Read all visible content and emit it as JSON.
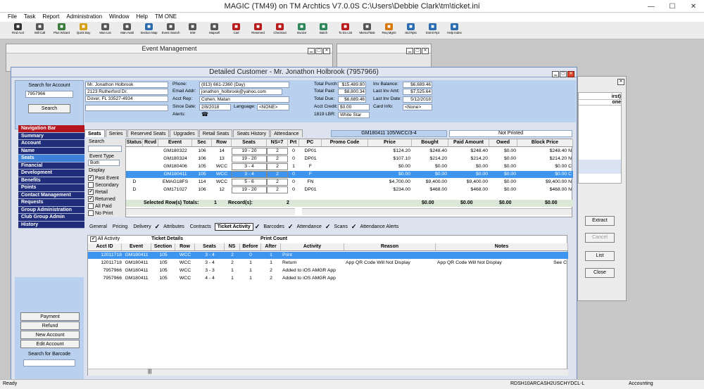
{
  "app_title": "MAGIC (TM49) on TM Archtics V7.0.0S C:\\Users\\Debbie Clark\\tm\\ticket.ini",
  "menu": [
    "File",
    "Task",
    "Report",
    "Administration",
    "Window",
    "Help",
    "TM ONE"
  ],
  "toolbar": [
    {
      "label": "Find Acct",
      "icon": "find-icon",
      "color": "#333333"
    },
    {
      "label": "Will Call",
      "icon": "will-call-icon",
      "color": "#555555"
    },
    {
      "label": "Plus Wizard",
      "icon": "wizard-icon",
      "color": "#3a7a3a"
    },
    {
      "label": "Quick Buy",
      "icon": "quick-buy-icon",
      "color": "#d4a017"
    },
    {
      "label": "Man List",
      "icon": "list-icon",
      "color": "#555555"
    },
    {
      "label": "Man Avail",
      "icon": "avail-icon",
      "color": "#555555"
    },
    {
      "label": "Section Map",
      "icon": "map-icon",
      "color": "#2b6cb0"
    },
    {
      "label": "Event Search",
      "icon": "search-icon",
      "color": "#555555"
    },
    {
      "label": "ISM",
      "icon": "ism-icon",
      "color": "#555555"
    },
    {
      "label": "Mapsell",
      "icon": "mapsell-icon",
      "color": "#555555"
    },
    {
      "label": "Cart",
      "icon": "cart-icon",
      "color": "#b91c1c"
    },
    {
      "label": "Reserved",
      "icon": "reserved-icon",
      "color": "#b91c1c"
    },
    {
      "label": "Checkout",
      "icon": "checkout-icon",
      "color": "#b91c1c"
    },
    {
      "label": "Invoice",
      "icon": "invoice-icon",
      "color": "#2f855a"
    },
    {
      "label": "Batch",
      "icon": "batch-icon",
      "color": "#2f855a"
    },
    {
      "label": "To Do List",
      "icon": "todo-icon",
      "color": "#b91c1c"
    },
    {
      "label": "Memo/Task",
      "icon": "memo-icon",
      "color": "#555555"
    },
    {
      "label": "Req Mgmt",
      "icon": "request-icon",
      "color": "#d97706"
    },
    {
      "label": "Std Rpts",
      "icon": "report-icon",
      "color": "#2b6cb0"
    },
    {
      "label": "Extrnl Rpt",
      "icon": "external-report-icon",
      "color": "#2b6cb0"
    },
    {
      "label": "Help Index",
      "icon": "help-icon",
      "color": "#2b6cb0"
    }
  ],
  "event_mgmt_title": "Event Management",
  "detail_title": "Detailed Customer - Mr. Jonathon Holbrook (7957966)",
  "search": {
    "label": "Search for Account",
    "value": "7957966",
    "button": "Search"
  },
  "address": [
    "Mr. Jonathon Holbrook",
    "2123 Rutherford Dr.",
    "Dover, FL  33527-4934"
  ],
  "contact": {
    "phone_label": "Phone:",
    "phone": "(813) 661-2360 (Day)",
    "email_label": "Email Addr:",
    "email": "jonathon_holbrook@yahoo.com",
    "rep_label": "Acct Rep:",
    "rep": "Cohen, Matan",
    "since_label": "Since Date:",
    "since": "2/8/2018",
    "language_label": "Language:",
    "language": "<NONE>",
    "alerts_label": "Alerts:"
  },
  "totals": {
    "purch_label": "Total Purch:",
    "purch": "$15,489.80",
    "paid_label": "Total Paid:",
    "paid": "$8,800.34",
    "due_label": "Total Due:",
    "due": "$6,689.46",
    "credit_label": "Acct Credit:",
    "credit": "$0.00",
    "lbr_label": "1819 LBR:",
    "lbr": "White Star",
    "inv_bal_label": "Inv Balance:",
    "inv_bal": "$6,689.46",
    "last_inv_amt_label": "Last Inv Amt:",
    "last_inv_amt": "$7,525.64",
    "last_inv_date_label": "Last Inv Date:",
    "last_inv_date": "5/12/2018",
    "card_label": "Card Info:",
    "card": "<None>"
  },
  "nav": [
    "Navigation Bar",
    "Summary",
    "Account",
    "Name",
    "Seats",
    "Financial",
    "Development",
    "Benefits",
    "Points",
    "Contact Management",
    "Requests",
    "Group Administration",
    "Club Group Admin",
    "History"
  ],
  "nav_selected": "Seats",
  "side_buttons": [
    "Payment",
    "Refund",
    "New Account",
    "Edit Account"
  ],
  "barcode_label": "Search for Barcode",
  "seats_tabs": [
    "Seats",
    "Series",
    "Reserved Seats",
    "Upgrades",
    "Retail Seats",
    "Seats History",
    "Attendance"
  ],
  "seats_info": {
    "event_box": "GM180411 105/WCC/3-4",
    "print_box": "Not Printed"
  },
  "seats_search_label": "Search",
  "event_type_label": "Event Type",
  "event_type_value": "Both",
  "display_label": "Display",
  "display_options": [
    {
      "label": "Past Event",
      "checked": "✔"
    },
    {
      "label": "Secondary",
      "checked": ""
    },
    {
      "label": "Retail",
      "checked": "✔"
    },
    {
      "label": "Returned",
      "checked": "✔"
    },
    {
      "label": "All Paid",
      "checked": ""
    },
    {
      "label": "No Print",
      "checked": ""
    }
  ],
  "seats_grid": {
    "headers": [
      "Status",
      "Rcvd",
      "Event",
      "Sec",
      "Row",
      "Seats",
      "NS=7",
      "Prt",
      "PC",
      "Promo Code",
      "Price",
      "Bought",
      "Paid Amount",
      "Owed",
      "Block Price"
    ],
    "rows": [
      [
        "",
        "",
        "GM180322",
        "106",
        "14",
        "19 - 20",
        "2",
        "0",
        "DP01",
        "",
        "$124.20",
        "$248.40",
        "$248.40",
        "$0.00",
        "$248.40 N"
      ],
      [
        "",
        "",
        "GM180324",
        "106",
        "13",
        "19 - 20",
        "2",
        "0",
        "DP01",
        "",
        "$107.10",
        "$214.20",
        "$214.20",
        "$0.00",
        "$214.20 N"
      ],
      [
        "",
        "",
        "GM180406",
        "105",
        "WCC",
        "3 - 4",
        "2",
        "1",
        "F",
        "",
        "$0.00",
        "$0.00",
        "$0.00",
        "$0.00",
        "$0.00 C"
      ],
      [
        "",
        "",
        "GM180411",
        "105",
        "WCC",
        "3 - 4",
        "2",
        "0",
        "F",
        "",
        "$0.00",
        "$0.00",
        "$0.00",
        "$0.00",
        "$0.00 C"
      ],
      [
        "D",
        "",
        "EMAG18FS",
        "114",
        "WCC",
        "5 - 6",
        "2",
        "0",
        "FN",
        "",
        "$4,700.00",
        "$9,400.00",
        "$9,400.00",
        "$0.00",
        "$9,400.00 N"
      ],
      [
        "D",
        "",
        "GM171027",
        "106",
        "12",
        "19 - 20",
        "2",
        "0",
        "DP01",
        "",
        "$234.00",
        "$468.00",
        "$468.00",
        "$0.00",
        "$468.00 N"
      ]
    ],
    "selected_row": 3,
    "totals_label": "Selected Row(s) Totals:",
    "totals_count": "1",
    "records_label": "Record(s):",
    "records_count": "2",
    "totals_values": [
      "$0.00",
      "$0.00",
      "$0.00",
      "$0.00"
    ]
  },
  "lower_tabs": [
    "General",
    "Pricing",
    "Delivery",
    "Attributes",
    "Contracts",
    "Ticket Activity",
    "Barcodes",
    "Attendance",
    "Scans",
    "Attendance Alerts"
  ],
  "activity": {
    "all_label": "All Activity",
    "group_ticket": "Ticket Details",
    "group_print": "Print Count",
    "headers": [
      "Acct ID",
      "Event",
      "Section",
      "Row",
      "Seats",
      "NS",
      "Before",
      "After",
      "Activity",
      "Reason",
      "Notes"
    ],
    "rows": [
      [
        "12011718",
        "GM180411",
        "105",
        "WCC",
        "3 - 4",
        "2",
        "0",
        "1",
        "Print",
        "",
        ""
      ],
      [
        "12011718",
        "GM180411",
        "105",
        "WCC",
        "3 - 4",
        "2",
        "1",
        "1",
        "Return",
        "App QR Code Will Not Display",
        "App QR Code Will Not Display"
      ],
      [
        "7957966",
        "GM180411",
        "105",
        "WCC",
        "3 - 3",
        "1",
        "1",
        "2",
        "Added to iOS AMGR App",
        "",
        ""
      ],
      [
        "7957966",
        "GM180411",
        "105",
        "WCC",
        "4 - 4",
        "1",
        "1",
        "2",
        "Added to iOS AMGR App",
        "",
        ""
      ]
    ],
    "row1_trailing": "See C"
  },
  "right_panel": {
    "partial_header": "irst)",
    "partial_header2": "one",
    "buttons": [
      "Extract",
      "Cancel",
      "List",
      "Close"
    ]
  },
  "status": {
    "left": "Ready",
    "code": "RDSH10ARCASH2USCHYDCL-L",
    "dept": "Accounting"
  }
}
